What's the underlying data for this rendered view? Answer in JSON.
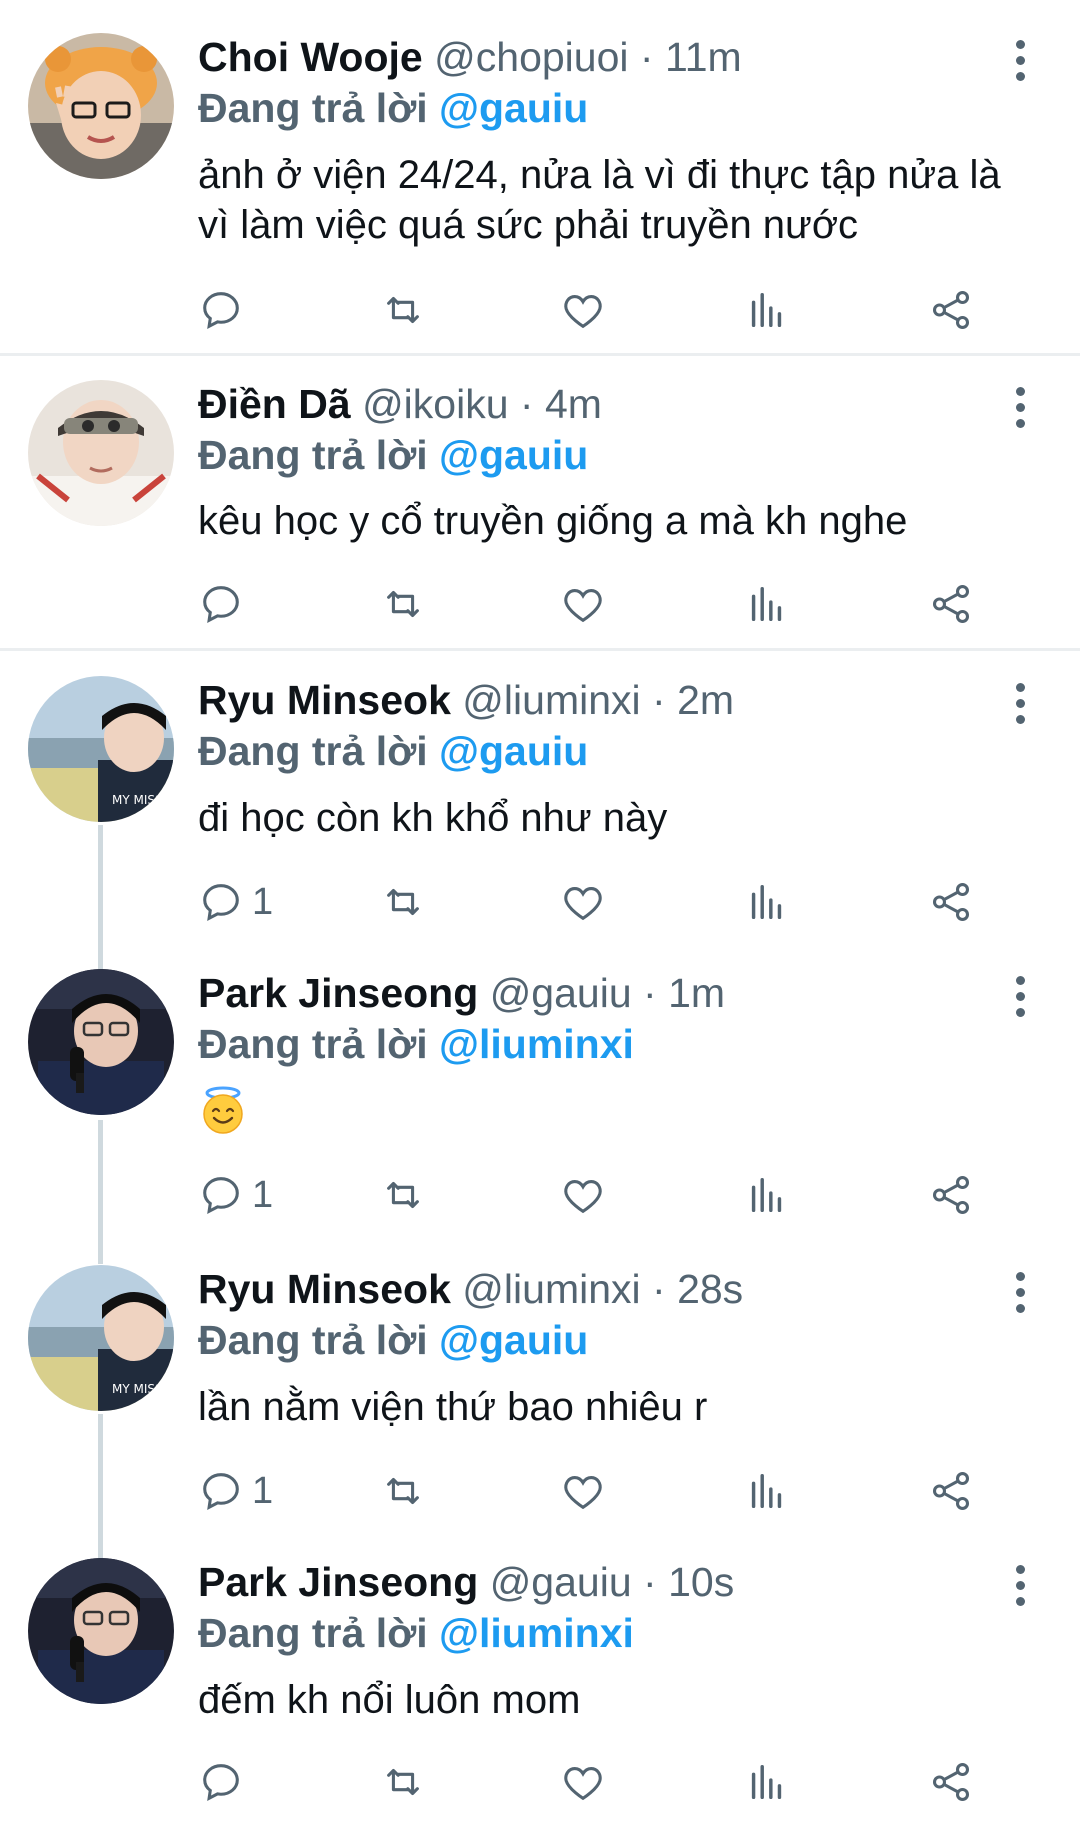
{
  "reply_label": "Đang trả lời",
  "tweets": [
    {
      "name": "Choi Wooje",
      "handle": "@chopiuoi",
      "time": "· 11m",
      "reply_to": "@gauiu",
      "text": "ảnh ở viện 24/24, nửa là vì đi thực tập nửa là vì làm việc quá sức phải truyền nước",
      "reply_count": "",
      "avatar": "avatar-1"
    },
    {
      "name": "Điền Dã",
      "handle": "@ikoiku",
      "time": "· 4m",
      "reply_to": "@gauiu",
      "text": "kêu học y cổ truyền giống a mà kh nghe",
      "reply_count": "",
      "avatar": "avatar-2"
    },
    {
      "name": "Ryu Minseok",
      "handle": "@liuminxi",
      "time": "· 2m",
      "reply_to": "@gauiu",
      "text": "đi học còn kh khổ như này",
      "reply_count": "1",
      "avatar": "avatar-3"
    },
    {
      "name": "Park Jinseong",
      "handle": "@gauiu",
      "time": "· 1m",
      "reply_to": "@liuminxi",
      "text": "",
      "emoji": "smiling-face-with-halo",
      "reply_count": "1",
      "avatar": "avatar-4"
    },
    {
      "name": "Ryu Minseok",
      "handle": "@liuminxi",
      "time": "· 28s",
      "reply_to": "@gauiu",
      "text": "lần nằm viện thứ bao nhiêu r",
      "reply_count": "1",
      "avatar": "avatar-3"
    },
    {
      "name": "Park Jinseong",
      "handle": "@gauiu",
      "time": "· 10s",
      "reply_to": "@liuminxi",
      "text": "đếm kh nổi luôn mom",
      "reply_count": "",
      "avatar": "avatar-4"
    }
  ],
  "icons": {
    "reply": "reply-icon",
    "retweet": "retweet-icon",
    "like": "heart-icon",
    "views": "views-icon",
    "share": "share-icon",
    "more": "more-icon"
  },
  "colors": {
    "mention": "#1d9bf0",
    "secondary_text": "#536471",
    "thread_line": "#cfd9de"
  }
}
